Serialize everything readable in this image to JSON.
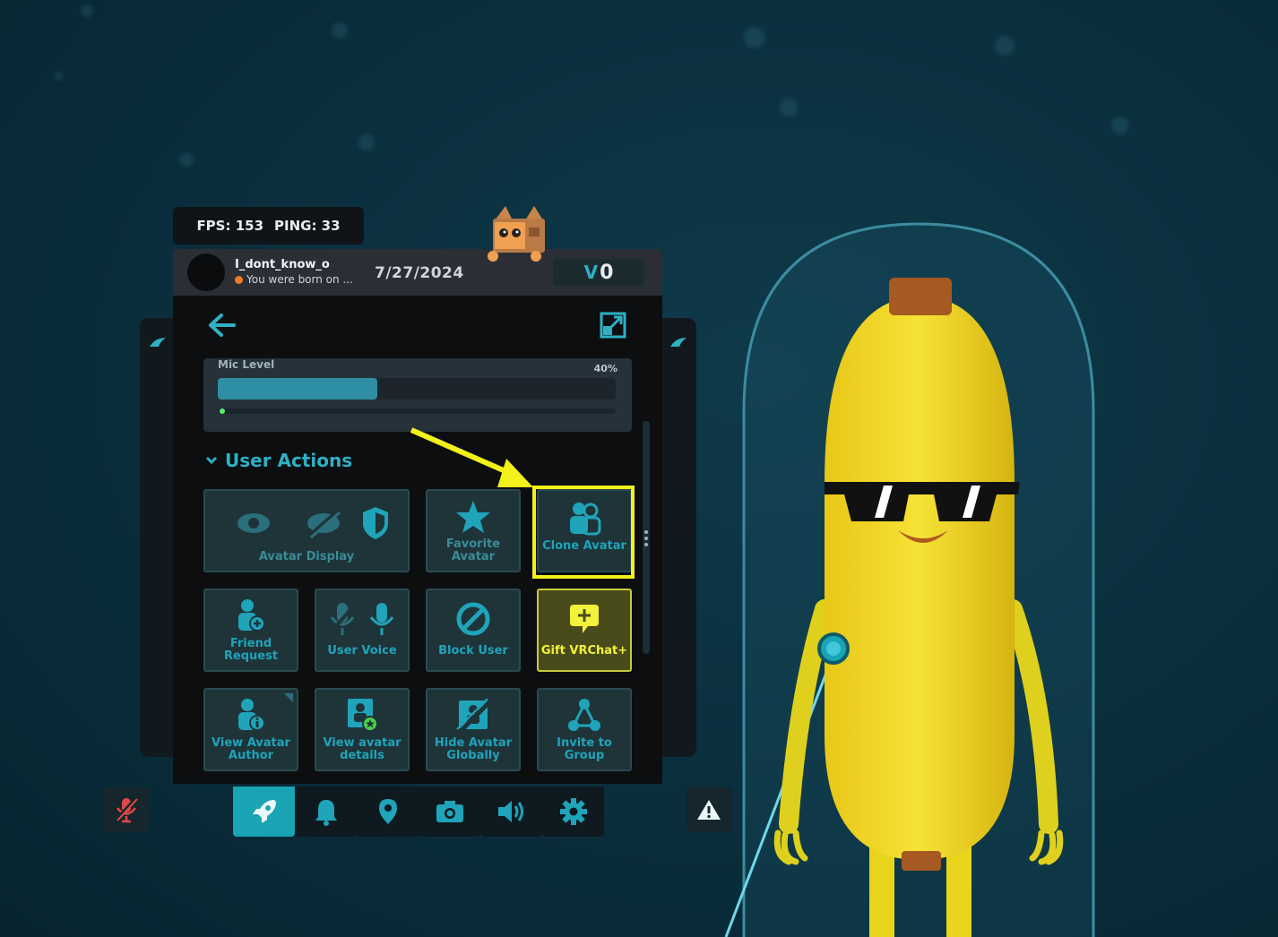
{
  "hud": {
    "fps": "FPS: 153",
    "ping": "PING: 33"
  },
  "profile": {
    "username": "I_dont_know_o",
    "status": "You were born on ...",
    "date": "7/27/2024",
    "currency_symbol": "V",
    "currency_value": "0"
  },
  "mic": {
    "label": "Mic Level",
    "percent_text": "40%",
    "level": 0.4
  },
  "section": {
    "title": "User Actions"
  },
  "tiles": {
    "avatar_display": "Avatar Display",
    "favorite_avatar": "Favorite\nAvatar",
    "clone_avatar": "Clone Avatar",
    "friend_request": "Friend\nRequest",
    "user_voice": "User Voice",
    "block_user": "Block User",
    "gift_vrchat": "Gift VRChat+",
    "view_avatar_author": "View Avatar\nAuthor",
    "view_avatar_details": "View avatar\ndetails",
    "hide_avatar_globally": "Hide Avatar\nGlobally",
    "invite_to_group": "Invite to\nGroup"
  },
  "colors": {
    "accent": "#1fa4ba",
    "highlight": "#f2f21a",
    "gift": "#f2f23a",
    "status_dot": "#f07a2a",
    "mute": "#e04848"
  },
  "icons": [
    "back-arrow-icon",
    "expand-icon",
    "eye-icon",
    "eye-off-icon",
    "shield-icon",
    "star-icon",
    "clone-people-icon",
    "add-friend-icon",
    "mic-off-icon",
    "mic-icon",
    "block-icon",
    "gift-chat-plus-icon",
    "user-info-icon",
    "avatar-details-icon",
    "hide-globally-icon",
    "group-icon",
    "rocket-icon",
    "bell-icon",
    "location-pin-icon",
    "camera-icon",
    "speaker-icon",
    "gear-icon",
    "warning-icon",
    "mic-muted-icon"
  ]
}
